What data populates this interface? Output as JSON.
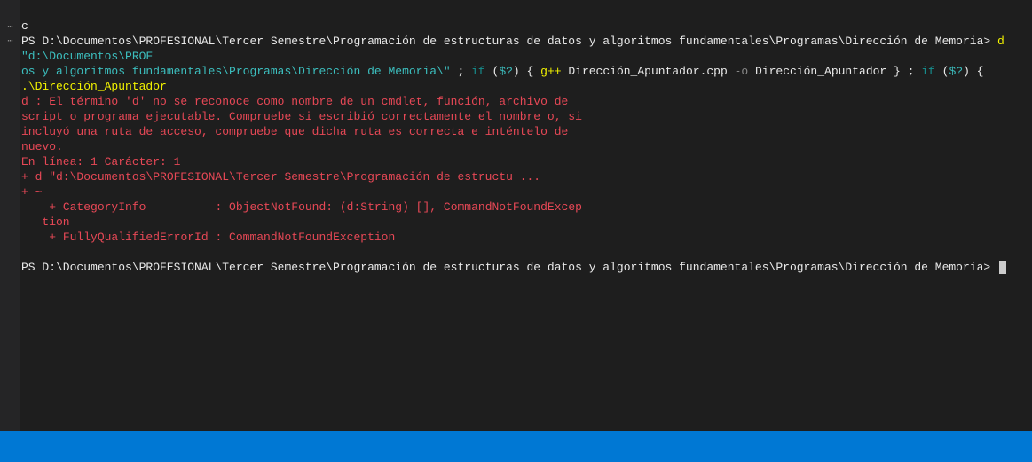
{
  "gutter": {
    "line1": "⋯",
    "line2": "⋯"
  },
  "terminal": {
    "line_c": "c",
    "prompt1_prefix": "PS ",
    "prompt1_path": "D:\\Documentos\\PROFESIONAL\\Tercer Semestre\\Programación de estructuras de datos y algoritmos fundamentales\\Programas\\Dirección de Memoria> ",
    "cmd_d": "d ",
    "cmd_path_start": "\"d:\\Documentos\\PROF",
    "cmd_path_cont": "os y algoritmos fundamentales\\Programas\\Dirección de Memoria\\\"",
    "sep1": " ; ",
    "if1": "if ",
    "paren_open1": "(",
    "dollar_q1": "$?",
    "paren_close_brace1": ") { ",
    "gpp": "g++",
    "gpp_args": " Dirección_Apuntador.cpp ",
    "dash_o": "-o",
    "out_name": " Dirección_Apuntador } ",
    "sep2": "; ",
    "if2": "if ",
    "paren_open2": "(",
    "dollar_q2": "$?",
    "paren_close_brace2": ") { ",
    "run_exe": ".\\Dirección_Apuntador",
    "err1": "d : El término 'd' no se reconoce como nombre de un cmdlet, función, archivo de",
    "err2": "script o programa ejecutable. Compruebe si escribió correctamente el nombre o, si",
    "err3": "incluyó una ruta de acceso, compruebe que dicha ruta es correcta e inténtelo de",
    "err4": "nuevo.",
    "err5": "En línea: 1 Carácter: 1",
    "err6": "+ d \"d:\\Documentos\\PROFESIONAL\\Tercer Semestre\\Programación de estructu ...",
    "err7": "+ ~",
    "err8": "    + CategoryInfo          : ObjectNotFound: (d:String) [], CommandNotFoundExcep",
    "err9": "   tion",
    "err10": "    + FullyQualifiedErrorId : CommandNotFoundException",
    "blank": "",
    "prompt2_prefix": "PS ",
    "prompt2_path": "D:\\Documentos\\PROFESIONAL\\Tercer Semestre\\Programación de estructuras de datos y algoritmos fundamentales\\Programas\\Dirección de Memoria> "
  }
}
